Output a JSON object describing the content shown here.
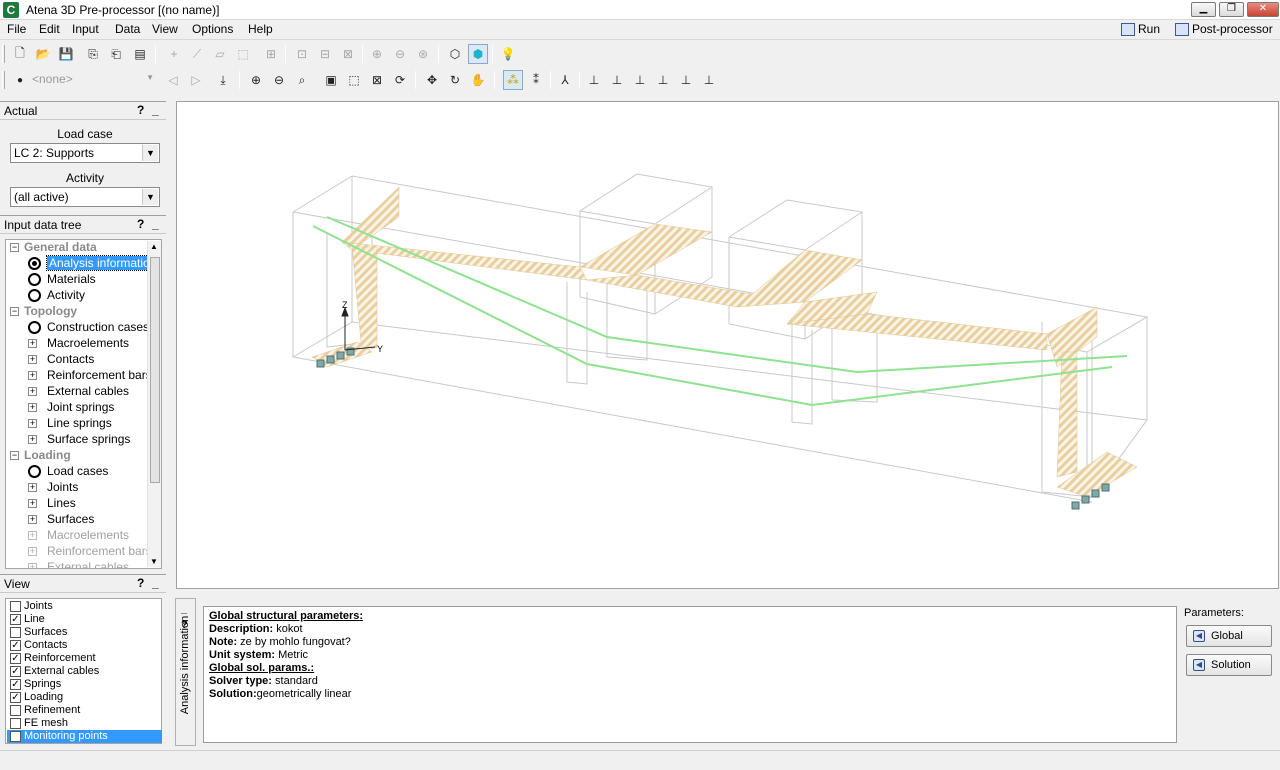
{
  "window": {
    "title": "Atena 3D Pre-processor [(no name)]",
    "app_icon_letter": "C",
    "controls": [
      "minimize",
      "maximize",
      "close"
    ]
  },
  "menu": {
    "items": [
      "File",
      "Edit",
      "Input",
      "Data",
      "View",
      "Options",
      "Help"
    ],
    "run_label": "Run",
    "postprocessor_label": "Post-processor"
  },
  "toolbar2": {
    "selector_placeholder": "<none>"
  },
  "actual_panel": {
    "title": "Actual",
    "help": "?",
    "minimize": "_",
    "load_case_label": "Load case",
    "load_case_value": "LC 2: Supports",
    "activity_label": "Activity",
    "activity_value": "(all active)"
  },
  "tree_panel": {
    "title": "Input data tree",
    "help": "?",
    "minimize": "_",
    "items": [
      {
        "label": "General data",
        "kind": "category"
      },
      {
        "label": "Analysis information",
        "kind": "circle-filled",
        "selected": true
      },
      {
        "label": "Materials",
        "kind": "circle"
      },
      {
        "label": "Activity",
        "kind": "circle"
      },
      {
        "label": "Topology",
        "kind": "category"
      },
      {
        "label": "Construction cases",
        "kind": "circle"
      },
      {
        "label": "Macroelements",
        "kind": "plus"
      },
      {
        "label": "Contacts",
        "kind": "plus"
      },
      {
        "label": "Reinforcement bars",
        "kind": "plus"
      },
      {
        "label": "External cables",
        "kind": "plus"
      },
      {
        "label": "Joint springs",
        "kind": "plus"
      },
      {
        "label": "Line springs",
        "kind": "plus"
      },
      {
        "label": "Surface springs",
        "kind": "plus"
      },
      {
        "label": "Loading",
        "kind": "category"
      },
      {
        "label": "Load cases",
        "kind": "circle"
      },
      {
        "label": "Joints",
        "kind": "plus"
      },
      {
        "label": "Lines",
        "kind": "plus"
      },
      {
        "label": "Surfaces",
        "kind": "plus"
      },
      {
        "label": "Macroelements",
        "kind": "plus",
        "disabled": true
      },
      {
        "label": "Reinforcement bars",
        "kind": "plus",
        "disabled": true
      },
      {
        "label": "External cables",
        "kind": "plus",
        "disabled": true
      }
    ]
  },
  "view_panel": {
    "title": "View",
    "help": "?",
    "minimize": "_",
    "items": [
      {
        "label": "Joints",
        "checked": false
      },
      {
        "label": "Line",
        "checked": true
      },
      {
        "label": "Surfaces",
        "checked": false
      },
      {
        "label": "Contacts",
        "checked": true
      },
      {
        "label": "Reinforcement",
        "checked": true
      },
      {
        "label": "External cables",
        "checked": true
      },
      {
        "label": "Springs",
        "checked": true
      },
      {
        "label": "Loading",
        "checked": true
      },
      {
        "label": "Refinement",
        "checked": false
      },
      {
        "label": "FE mesh",
        "checked": false
      },
      {
        "label": "Monitoring points",
        "checked": false,
        "highlighted": true
      }
    ]
  },
  "viewport": {
    "axis_labels": {
      "z": "Z",
      "y": "Y"
    },
    "colors": {
      "wire": "#c8c8c8",
      "cable": "#8fe28f",
      "hatch": "#e8cfa0"
    }
  },
  "info_panel": {
    "side_label": "Analysis information",
    "side_help": "?",
    "side_minimize": "_",
    "heading1": "Global structural parameters:",
    "description_key": "Description:",
    "description_val": "kokot",
    "note_key": "Note:",
    "note_val": "ze by mohlo fungovat?",
    "unit_key": "Unit system:",
    "unit_val": "Metric",
    "heading2": "Global sol. params.:",
    "solver_key": "Solver type:",
    "solver_val": "standard",
    "solution_key": "Solution:",
    "solution_val": "geometrically linear",
    "params_label": "Parameters:",
    "global_button": "Global",
    "solution_button": "Solution"
  }
}
